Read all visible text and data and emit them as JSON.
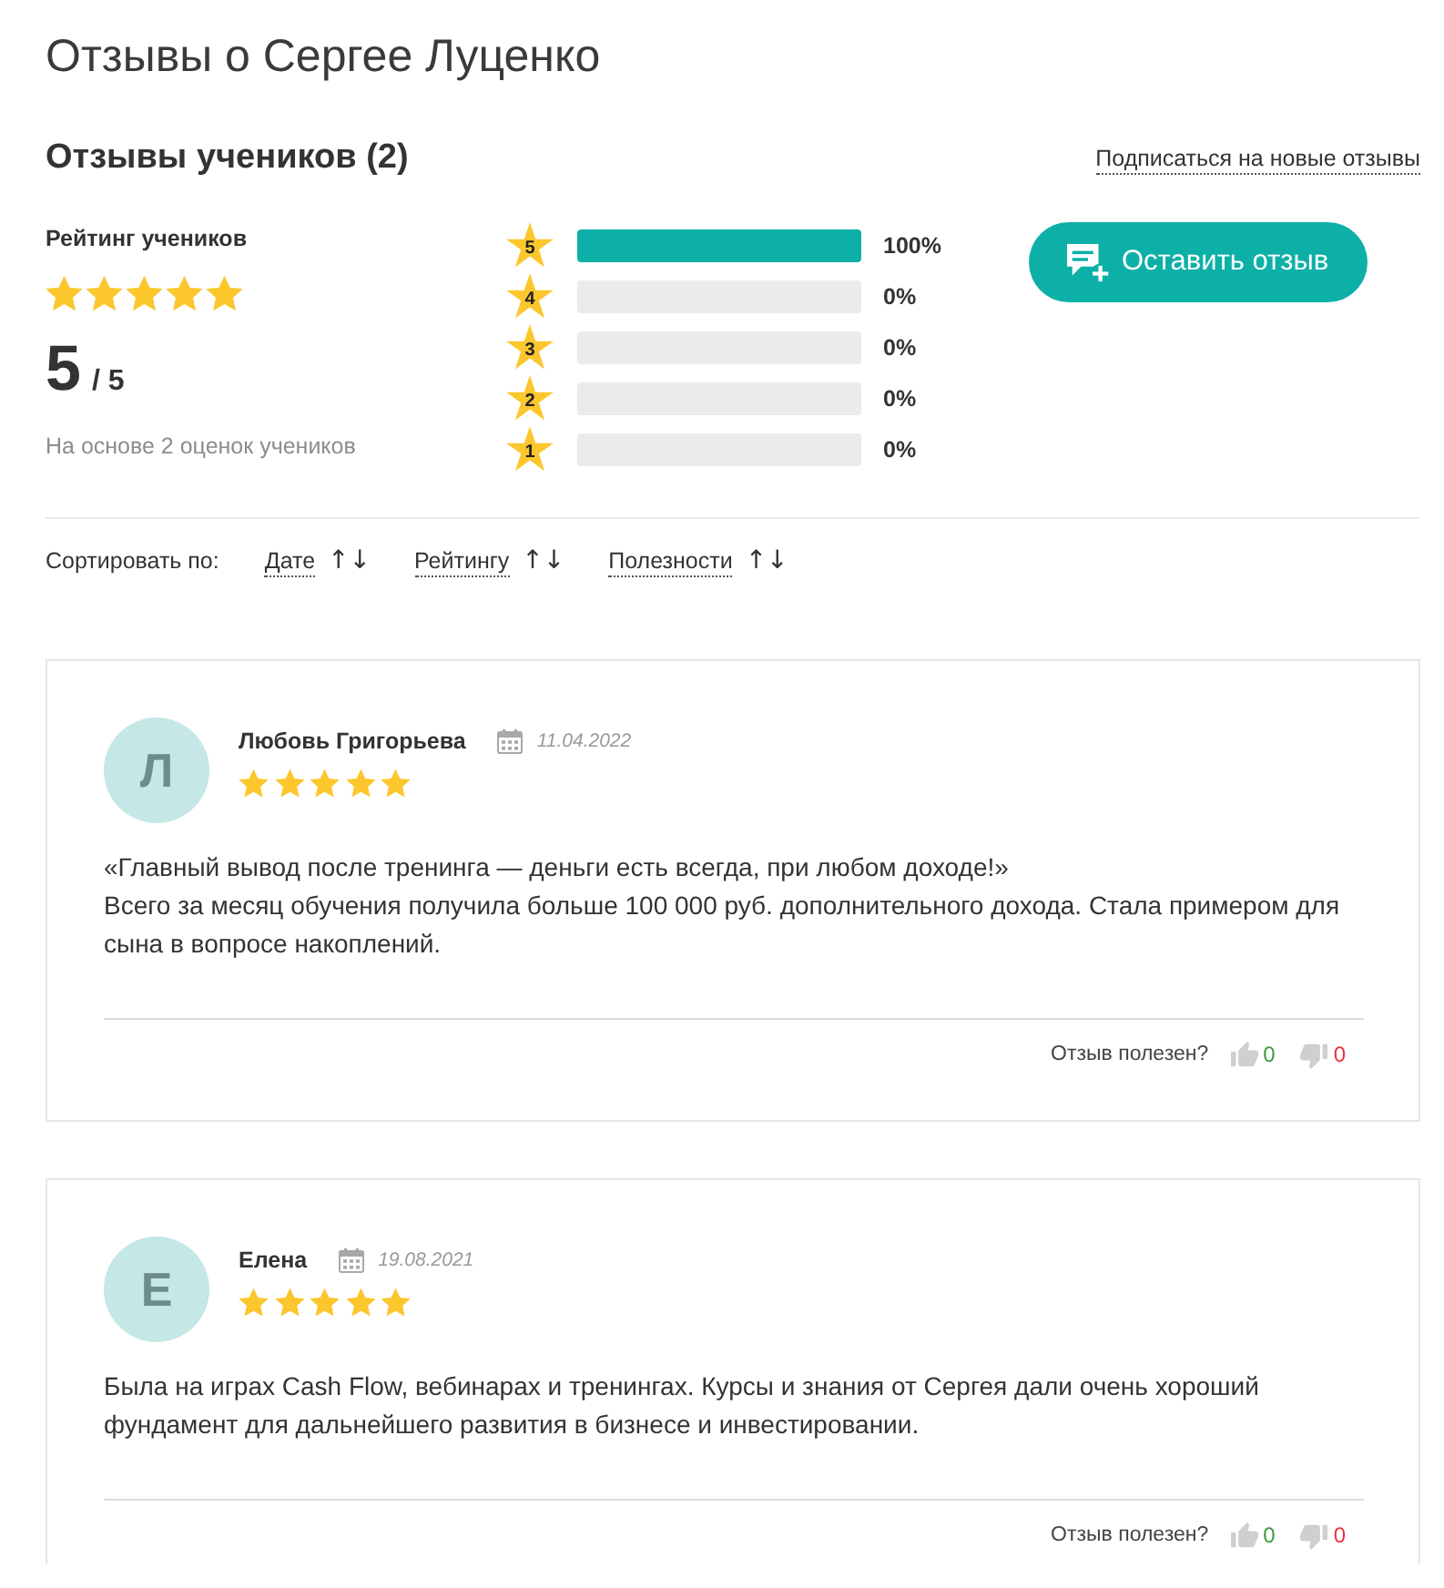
{
  "page_title": "Отзывы о Сергее Луценко",
  "section": {
    "title": "Отзывы учеников (2)",
    "subscribe_link": "Подписаться на новые отзывы"
  },
  "summary": {
    "label": "Рейтинг учеников",
    "stars": 5,
    "score": "5",
    "out_of": "/ 5",
    "basis": "На основе 2 оценок учеников"
  },
  "distribution": [
    {
      "star": "5",
      "level": 1,
      "percent": "100%"
    },
    {
      "star": "4",
      "level": 0,
      "percent": "0%"
    },
    {
      "star": "3",
      "level": 0,
      "percent": "0%"
    },
    {
      "star": "2",
      "level": 0,
      "percent": "0%"
    },
    {
      "star": "1",
      "level": 0,
      "percent": "0%"
    }
  ],
  "leave_review_button": "Оставить отзыв",
  "sort": {
    "label": "Сортировать по:",
    "options": [
      {
        "label": "Дате",
        "arrows": "↑↓"
      },
      {
        "label": "Рейтингу",
        "arrows": "↑↓"
      },
      {
        "label": "Полезности",
        "arrows": "↑↓"
      }
    ]
  },
  "reviews": [
    {
      "initial": "Л",
      "name": "Любовь Григорьева",
      "date": "11.04.2022",
      "stars": 5,
      "paragraphs": [
        "«Главный вывод после тренинга — деньги есть всегда, при любом доходе!»",
        "Всего за месяц обучения получила больше 100 000 руб. дополнительного дохода. Стала примером для сына в вопросе накоплений."
      ],
      "helpful_label": "Отзыв полезен?",
      "likes": "0",
      "dislikes": "0"
    },
    {
      "initial": "Е",
      "name": "Елена",
      "date": "19.08.2021",
      "stars": 5,
      "paragraphs": [
        "Была на играх Cash Flow, вебинарах и тренингах. Курсы и знания от Сергея дали очень хороший фундамент для дальнейшего развития в бизнесе и инвестировании."
      ],
      "helpful_label": "Отзыв полезен?",
      "likes": "0",
      "dislikes": "0"
    }
  ]
}
